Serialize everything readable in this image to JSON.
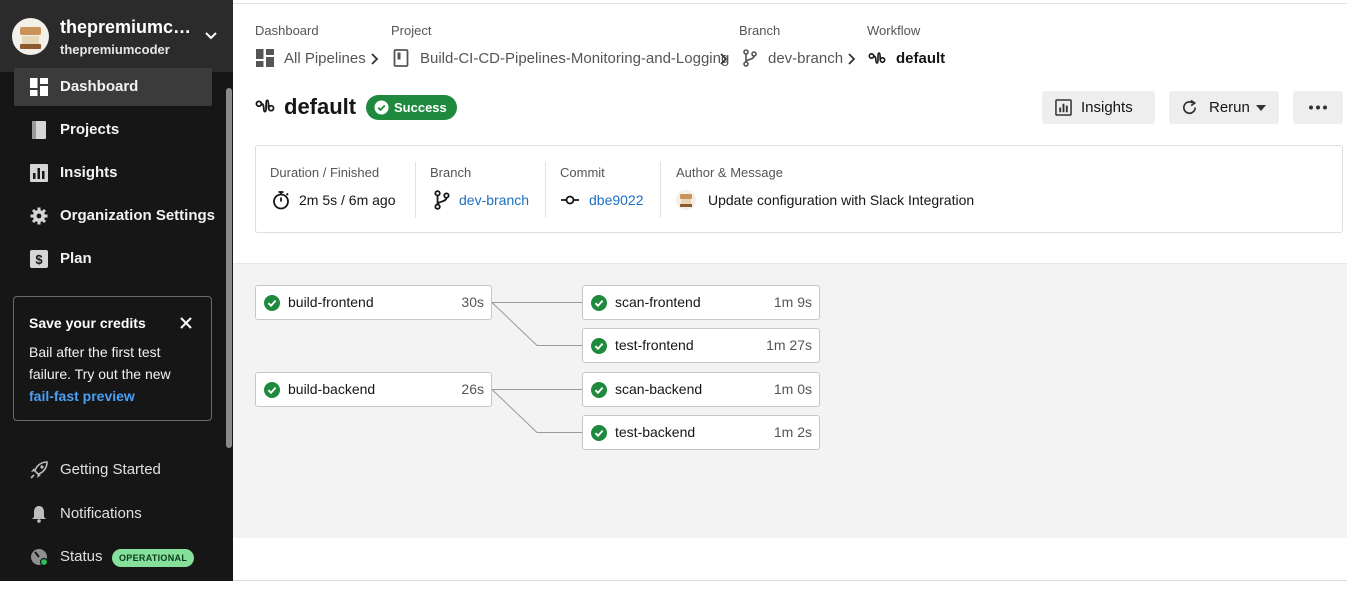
{
  "org": {
    "name": "thepremiumcoder",
    "username": "thepremiumcoder"
  },
  "sidebar": {
    "items": [
      {
        "label": "Dashboard",
        "icon": "dashboard-icon",
        "active": true
      },
      {
        "label": "Projects",
        "icon": "projects-icon"
      },
      {
        "label": "Insights",
        "icon": "insights-icon"
      },
      {
        "label": "Organization Settings",
        "icon": "gear-icon"
      },
      {
        "label": "Plan",
        "icon": "dollar-icon"
      }
    ],
    "promo": {
      "title": "Save your credits",
      "body": "Bail after the first test failure. Try out the new",
      "link": "fail-fast preview"
    },
    "footer": [
      {
        "label": "Getting Started",
        "icon": "rocket-icon"
      },
      {
        "label": "Notifications",
        "icon": "bell-icon"
      },
      {
        "label": "Status",
        "icon": "status-icon",
        "badge": "OPERATIONAL"
      }
    ]
  },
  "breadcrumb": {
    "dashboard": {
      "caption": "Dashboard",
      "value": "All Pipelines"
    },
    "project": {
      "caption": "Project",
      "value": "Build-CI-CD-Pipelines-Monitoring-and-Logging"
    },
    "branch": {
      "caption": "Branch",
      "value": "dev-branch"
    },
    "workflow": {
      "caption": "Workflow",
      "value": "default"
    }
  },
  "header": {
    "title": "default",
    "status": "Success",
    "insights_label": "Insights",
    "rerun_label": "Rerun"
  },
  "summary": {
    "duration": {
      "caption": "Duration / Finished",
      "value": "2m 5s / 6m ago"
    },
    "branch": {
      "caption": "Branch",
      "value": "dev-branch"
    },
    "commit": {
      "caption": "Commit",
      "value": "dbe9022"
    },
    "author": {
      "caption": "Author & Message",
      "value": "Update configuration with Slack Integration"
    }
  },
  "jobs": [
    {
      "name": "build-frontend",
      "duration": "30s",
      "status": "success"
    },
    {
      "name": "scan-frontend",
      "duration": "1m 9s",
      "status": "success"
    },
    {
      "name": "test-frontend",
      "duration": "1m 27s",
      "status": "success"
    },
    {
      "name": "build-backend",
      "duration": "26s",
      "status": "success"
    },
    {
      "name": "scan-backend",
      "duration": "1m 0s",
      "status": "success"
    },
    {
      "name": "test-backend",
      "duration": "1m 2s",
      "status": "success"
    }
  ],
  "colors": {
    "sidebar_bg": "#161616",
    "success": "#1f8a3e",
    "link": "#1c6fc2",
    "promo_link": "#4a9ff5",
    "operational_badge": "#84e09b"
  }
}
